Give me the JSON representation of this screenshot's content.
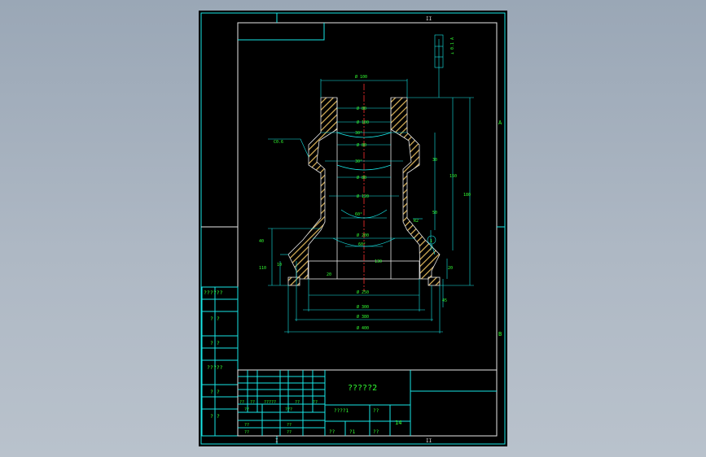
{
  "title_block": {
    "part_name": "?????2",
    "cells_mid": [
      "??",
      "??",
      "?????",
      "??",
      "??",
      "??",
      "???",
      "??",
      "??",
      "??",
      "??"
    ],
    "cell_material": "????1",
    "cell_scale_label": "??",
    "cell_scale_value": "14",
    "cell_bottom_a": "??",
    "cell_bottom_b": "?1",
    "cell_bottom_c": "??"
  },
  "left_strip": {
    "labels": [
      "??????",
      "? ?",
      "? ?",
      "?????",
      "? ?",
      "? ?"
    ]
  },
  "border_marks": {
    "top": [
      "I",
      "II"
    ],
    "bottom": [
      "I",
      "II"
    ],
    "right": [
      "A",
      "B"
    ]
  },
  "dims": {
    "top_outer": "Ø 100",
    "d1": "Ø 80",
    "d2": "Ø 100",
    "d3": "30°",
    "d4": "Ø 80",
    "d5": "30°",
    "d6": "Ø 80",
    "d7": "Ø 120",
    "d8": "60°",
    "d9": "Ø 200",
    "d10": "60°",
    "bot1": "Ø 250",
    "bot2": "Ø 300",
    "bot3": "Ø 380",
    "bot4": "Ø 400",
    "left_chamfer": "C0.6",
    "left_h1": "40",
    "left_h2": "110",
    "left_h3": "10",
    "inner_h": "20",
    "right_h1": "50",
    "right_h2": "150",
    "right_h3": "130",
    "right_h4": "180",
    "right_h5": "20",
    "right_h6": "45",
    "right_mid": "30",
    "circle_label": "1",
    "small_r": "R2",
    "tol_box": "⊥ 0.1 A"
  }
}
